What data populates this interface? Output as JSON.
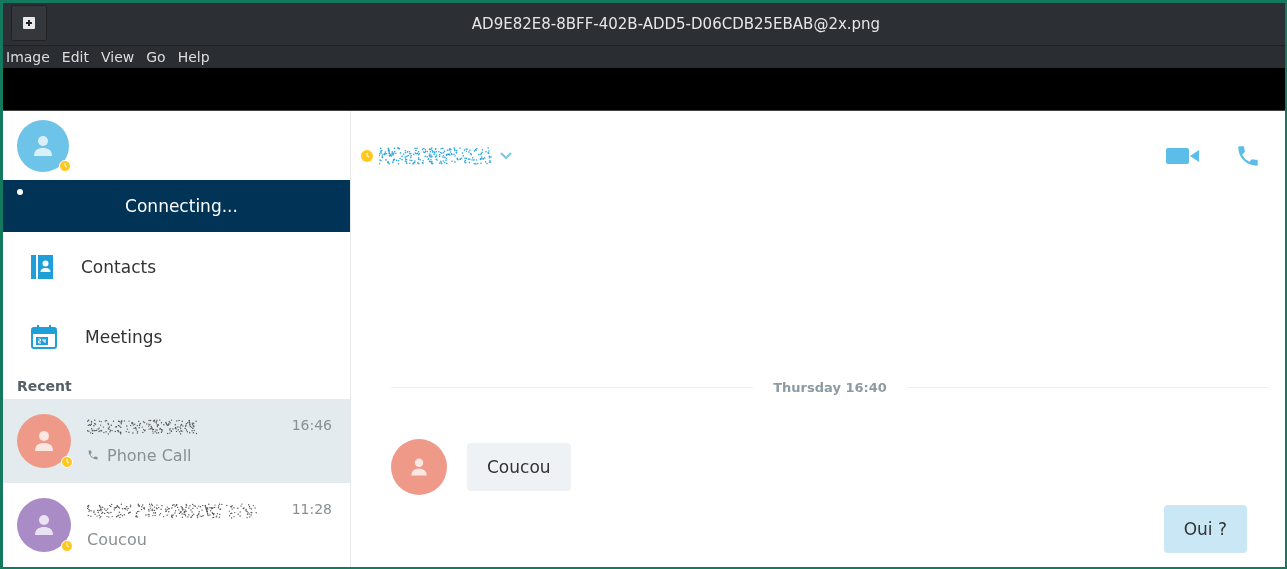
{
  "window": {
    "title": "AD9E82E8-8BFF-402B-ADD5-D06CDB25EBAB@2x.png"
  },
  "menu": [
    "Image",
    "Edit",
    "View",
    "Go",
    "Help"
  ],
  "sidebar": {
    "connection_status": "Connecting...",
    "nav": [
      {
        "label": "Contacts",
        "kind": "contacts"
      },
      {
        "label": "Meetings",
        "kind": "meetings"
      }
    ],
    "recent_heading": "Recent",
    "recent": [
      {
        "time": "16:46",
        "preview": "Phone Call",
        "kind": "call",
        "color": "#ef9a88",
        "selected": true
      },
      {
        "time": "11:28",
        "preview": "Coucou",
        "kind": "text",
        "color": "#a98bc6",
        "selected": false
      }
    ]
  },
  "chat": {
    "date_divider": "Thursday 16:40",
    "messages": [
      {
        "text": "Coucou",
        "kind": "incoming"
      },
      {
        "text": "Oui ?",
        "kind": "outgoing"
      }
    ]
  }
}
